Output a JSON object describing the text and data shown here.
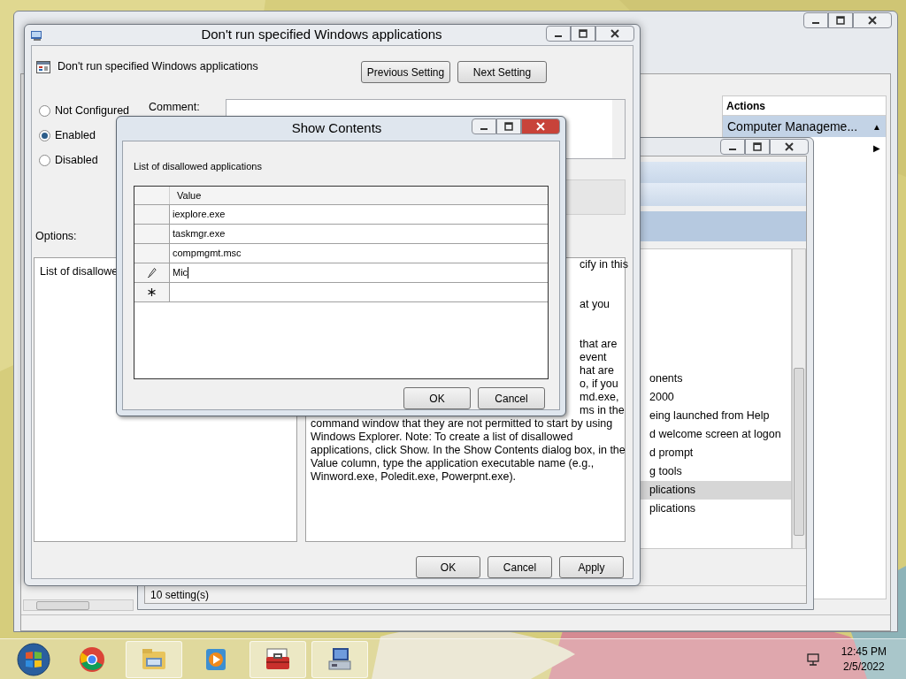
{
  "computer_management": {
    "actions_header": "Actions",
    "actions_item": {
      "label": "Computer Manageme...",
      "selected": true,
      "glyph": "▲"
    },
    "submenu_glyph": "▶"
  },
  "policy_window": {
    "items": [
      {
        "label": "onents",
        "selected": false
      },
      {
        "label": "2000",
        "selected": false
      },
      {
        "label": "eing launched from Help",
        "selected": false
      },
      {
        "label": "d welcome screen at logon",
        "selected": false
      },
      {
        "label": "d prompt",
        "selected": false
      },
      {
        "label": "g tools",
        "selected": false
      },
      {
        "label": "plications",
        "selected": true
      },
      {
        "label": "plications",
        "selected": false
      }
    ],
    "status": "10 setting(s)"
  },
  "dialog": {
    "title": "Don't run specified Windows applications",
    "heading": "Don't run specified Windows applications",
    "nav_buttons": [
      "Previous Setting",
      "Next Setting"
    ],
    "radios": [
      {
        "label": "Not Configured",
        "selected": false
      },
      {
        "label": "Enabled",
        "selected": true
      },
      {
        "label": "Disabled",
        "selected": false
      }
    ],
    "comment_label": "Comment:",
    "options_label": "Options:",
    "options_text": "List of disallowe",
    "help_paragraphs": [
      [
        {
          "kind": "fragment",
          "text": "cify in this"
        }
      ],
      [
        {
          "kind": "fragment",
          "text": "at you"
        }
      ],
      [
        {
          "kind": "fragment",
          "text": "that are"
        },
        {
          "kind": "fragment",
          "text": "event"
        },
        {
          "kind": "fragment",
          "text": "hat are"
        },
        {
          "kind": "fragment",
          "text": "o, if you"
        },
        {
          "kind": "fragment",
          "text": "md.exe,"
        },
        {
          "kind": "fragment",
          "text": "ms in the"
        },
        {
          "kind": "line",
          "text": "command window that they are not permitted to start by using"
        },
        {
          "kind": "line",
          "text": "Windows Explorer. Note: To create a list of disallowed"
        },
        {
          "kind": "line",
          "text": "applications, click Show. In the Show Contents dialog box, in the"
        },
        {
          "kind": "line",
          "text": "Value column, type the application executable name (e.g.,"
        },
        {
          "kind": "line",
          "text": "Winword.exe, Poledit.exe, Powerpnt.exe)."
        }
      ]
    ],
    "buttons": [
      "OK",
      "Cancel",
      "Apply"
    ]
  },
  "show_contents": {
    "title": "Show Contents",
    "label": "List of disallowed applications",
    "column": "Value",
    "rows": [
      {
        "kind": "saved",
        "value": "iexplore.exe"
      },
      {
        "kind": "saved",
        "value": "taskmgr.exe"
      },
      {
        "kind": "saved",
        "value": "compmgmt.msc"
      },
      {
        "kind": "editing",
        "value": "Mic"
      },
      {
        "kind": "new"
      }
    ],
    "buttons": [
      "OK",
      "Cancel"
    ]
  },
  "taskbar": {
    "apps": [
      {
        "kind": "browser",
        "active": false
      },
      {
        "kind": "explorer",
        "active": true
      },
      {
        "kind": "media",
        "active": false
      },
      {
        "kind": "toolbox",
        "active": true
      },
      {
        "kind": "computer",
        "active": true
      }
    ],
    "time": "12:45 PM",
    "date": "2/5/2022"
  }
}
